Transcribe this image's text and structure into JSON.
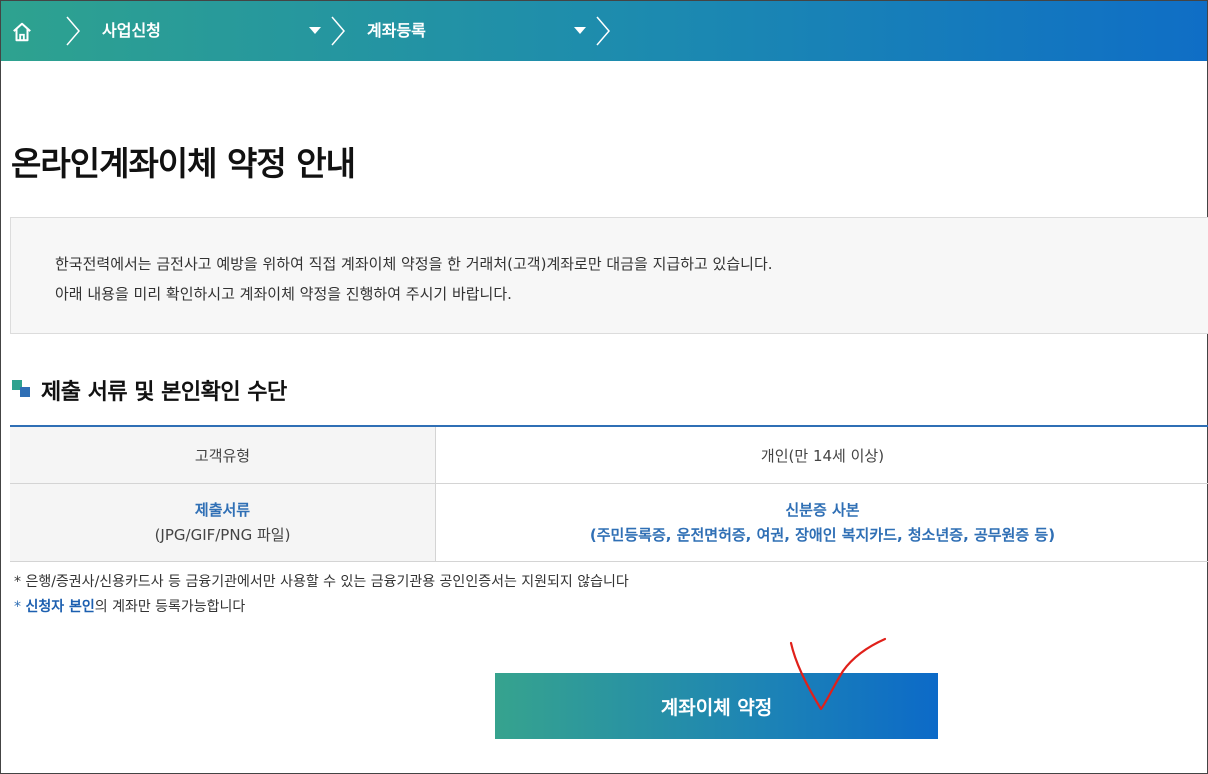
{
  "breadcrumb": {
    "items": [
      "사업신청",
      "계좌등록"
    ]
  },
  "page": {
    "title": "온라인계좌이체 약정 안내"
  },
  "notice": {
    "line1": "한국전력에서는 금전사고 예방을 위하여 직접 계좌이체 약정을 한 거래처(고객)계좌로만 대금을 지급하고 있습니다.",
    "line2": "아래 내용을 미리 확인하시고 계좌이체 약정을 진행하여 주시기 바랍니다."
  },
  "section": {
    "title": "제출 서류 및 본인확인 수단"
  },
  "table": {
    "rows": [
      {
        "header": "고객유형",
        "value": "개인(만 14세 이상)"
      },
      {
        "header": "제출서류",
        "header_sub": "(JPG/GIF/PNG 파일)",
        "value": "신분증 사본",
        "value_sub": "(주민등록증, 운전면허증, 여권, 장애인 복지카드, 청소년증, 공무원증 등)"
      }
    ]
  },
  "notes": {
    "note1": "* 은행/증권사/신용카드사 등 금융기관에서만 사용할 수 있는 금융기관용 공인인증서는 지원되지 않습니다",
    "note2_prefix": "* ",
    "note2_highlight": "신청자 본인",
    "note2_suffix": "의 계좌만 등록가능합니다"
  },
  "button": {
    "agree_label": "계좌이체 약정"
  },
  "colors": {
    "accent_blue": "#2f6fb5",
    "gradient_start": "#2ea28f",
    "gradient_end": "#0f6ec6",
    "annotation_red": "#e0201a"
  },
  "icons": {
    "home": "home-icon",
    "breadcrumb_separator": "chevron-right-icon",
    "dropdown": "caret-down-icon",
    "section": "section-squares-icon"
  }
}
